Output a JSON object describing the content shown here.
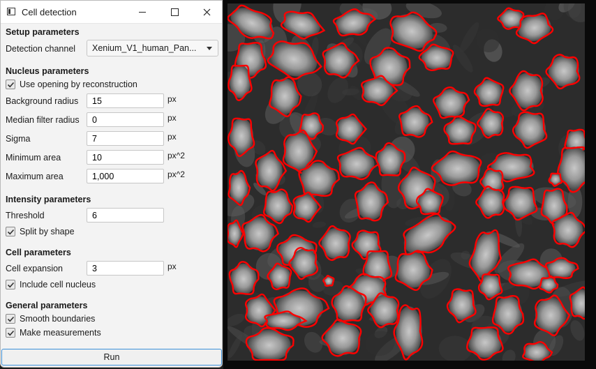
{
  "window": {
    "title": "Cell detection",
    "app_icon": "window-icon",
    "controls": [
      "minimize-icon",
      "maximize-icon",
      "close-icon"
    ]
  },
  "setup": {
    "heading": "Setup parameters",
    "channel_label": "Detection channel",
    "channel_value": "Xenium_V1_human_Pan..."
  },
  "nucleus": {
    "heading": "Nucleus parameters",
    "opening_label": "Use opening by reconstruction",
    "opening_checked": true,
    "background_radius": {
      "label": "Background radius",
      "value": "15",
      "unit": "px"
    },
    "median_filter": {
      "label": "Median filter radius",
      "value": "0",
      "unit": "px"
    },
    "sigma": {
      "label": "Sigma",
      "value": "7",
      "unit": "px"
    },
    "min_area": {
      "label": "Minimum area",
      "value": "10",
      "unit": "px^2"
    },
    "max_area": {
      "label": "Maximum area",
      "value": "1,000",
      "unit": "px^2"
    }
  },
  "intensity": {
    "heading": "Intensity parameters",
    "threshold": {
      "label": "Threshold",
      "value": "6"
    },
    "split_label": "Split by shape",
    "split_checked": true
  },
  "cell": {
    "heading": "Cell parameters",
    "expansion": {
      "label": "Cell expansion",
      "value": "3",
      "unit": "px"
    },
    "include_nucleus_label": "Include cell nucleus",
    "include_nucleus_checked": true
  },
  "general": {
    "heading": "General parameters",
    "smooth_label": "Smooth boundaries",
    "smooth_checked": true,
    "measure_label": "Make measurements",
    "measure_checked": true
  },
  "run_label": "Run",
  "viewer": {
    "outline_color": "#ff0000",
    "background": "#0a0a0a"
  }
}
